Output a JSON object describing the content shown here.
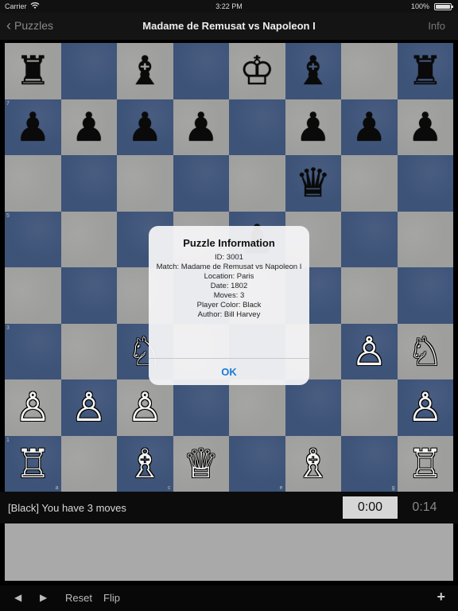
{
  "status_bar": {
    "carrier": "Carrier",
    "time": "3:22 PM",
    "battery": "100%"
  },
  "nav": {
    "back_label": "Puzzles",
    "title": "Madame de Remusat vs Napoleon I",
    "info_label": "Info"
  },
  "board": {
    "rows": [
      [
        "♜",
        "",
        "♝",
        "",
        "♔",
        "♝",
        "",
        "♜"
      ],
      [
        "♟",
        "♟",
        "♟",
        "♟",
        "",
        "♟",
        "♟",
        "♟"
      ],
      [
        "",
        "",
        "",
        "",
        "",
        "♛",
        "",
        ""
      ],
      [
        "",
        "",
        "",
        "",
        "♟",
        "",
        "",
        ""
      ],
      [
        "",
        "",
        "",
        "",
        "",
        "",
        "",
        ""
      ],
      [
        "",
        "",
        "♘",
        "",
        "",
        "",
        "♙",
        "♘"
      ],
      [
        "♙",
        "♙",
        "♙",
        "",
        "",
        "",
        "",
        "♙"
      ],
      [
        "♖",
        "",
        "♗",
        "♕",
        "",
        "♗",
        "",
        "♖"
      ]
    ],
    "piece_colors": [
      [
        "b",
        "",
        "b",
        "",
        "b",
        "b",
        "",
        "b"
      ],
      [
        "b",
        "b",
        "b",
        "b",
        "",
        "b",
        "b",
        "b"
      ],
      [
        "",
        "",
        "",
        "",
        "",
        "b",
        "",
        ""
      ],
      [
        "",
        "",
        "",
        "",
        "b",
        "",
        "",
        ""
      ],
      [
        "",
        "",
        "",
        "",
        "",
        "",
        "",
        ""
      ],
      [
        "",
        "",
        "w",
        "",
        "",
        "",
        "w",
        "w"
      ],
      [
        "w",
        "w",
        "w",
        "",
        "",
        "",
        "",
        "w"
      ],
      [
        "w",
        "",
        "w",
        "w",
        "",
        "w",
        "",
        "w"
      ]
    ],
    "rank_labels": [
      "",
      "7",
      "",
      "5",
      "",
      "3",
      "",
      "1"
    ],
    "file_labels": [
      "a",
      "",
      "c",
      "",
      "e",
      "",
      "g",
      ""
    ]
  },
  "message": "[Black] You have 3 moves",
  "clock_active": "0:00",
  "clock_other": "0:14",
  "toolbar": {
    "prev_icon": "◀",
    "next_icon": "▶",
    "reset_label": "Reset",
    "flip_label": "Flip",
    "add_icon": "+"
  },
  "dialog": {
    "title": "Puzzle Information",
    "id_line": "ID: 3001",
    "match_line": "Match: Madame de Remusat vs Napoleon I",
    "location_line": "Location:  Paris",
    "date_line": "Date: 1802",
    "moves_line": "Moves: 3",
    "player_color_line": "Player Color: Black",
    "author_line": "Author: Bill Harvey",
    "ok_label": "OK"
  }
}
